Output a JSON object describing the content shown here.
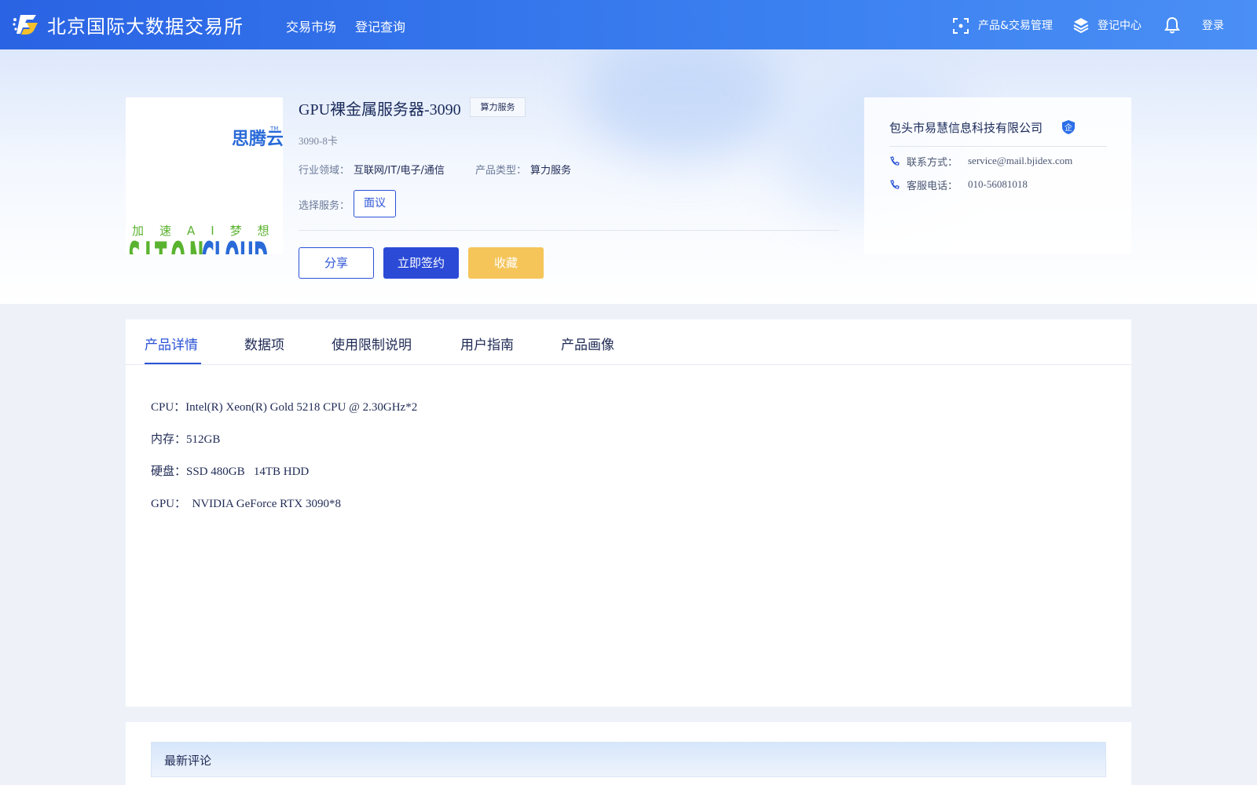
{
  "header": {
    "brand": "北京国际大数据交易所",
    "nav": [
      "交易市场",
      "登记查询"
    ],
    "right": {
      "product_mgmt": "产品&交易管理",
      "registry": "登记中心",
      "login": "登录"
    }
  },
  "product": {
    "title": "GPU裸金属服务器-3090",
    "tag": "算力服务",
    "subtitle": "3090-8卡",
    "industry_label": "行业领域：",
    "industry_value": "互联网/IT/电子/通信",
    "type_label": "产品类型：",
    "type_value": "算力服务",
    "service_label": "选择服务：",
    "service_option": "面议",
    "buttons": {
      "share": "分享",
      "sign": "立即签约",
      "favorite": "收藏"
    }
  },
  "seller": {
    "name": "包头市易慧信息科技有限公司",
    "badge": "企",
    "contact_label": "联系方式：",
    "contact_value": "service@mail.bjidex.com",
    "phone_label": "客服电话：",
    "phone_value": "010-56081018"
  },
  "tabs": [
    "产品详情",
    "数据项",
    "使用限制说明",
    "用户指南",
    "产品画像"
  ],
  "specs": [
    "CPU：Intel(R) Xeon(R) Gold 5218 CPU @ 2.30GHz*2",
    "内存：512GB",
    "硬盘：SSD 480GB   14TB HDD",
    "GPU：  NVIDIA GeForce RTX 3090*8"
  ],
  "comments": {
    "title": "最新评论"
  },
  "logo_image_text": {
    "cn": "思腾云",
    "en": "SITONCLOUD",
    "slogan": "加 速 AI 梦 想"
  },
  "colors": {
    "primary": "#2b53d6",
    "favorite": "#f5c55a",
    "nav": "#2a63e3"
  }
}
